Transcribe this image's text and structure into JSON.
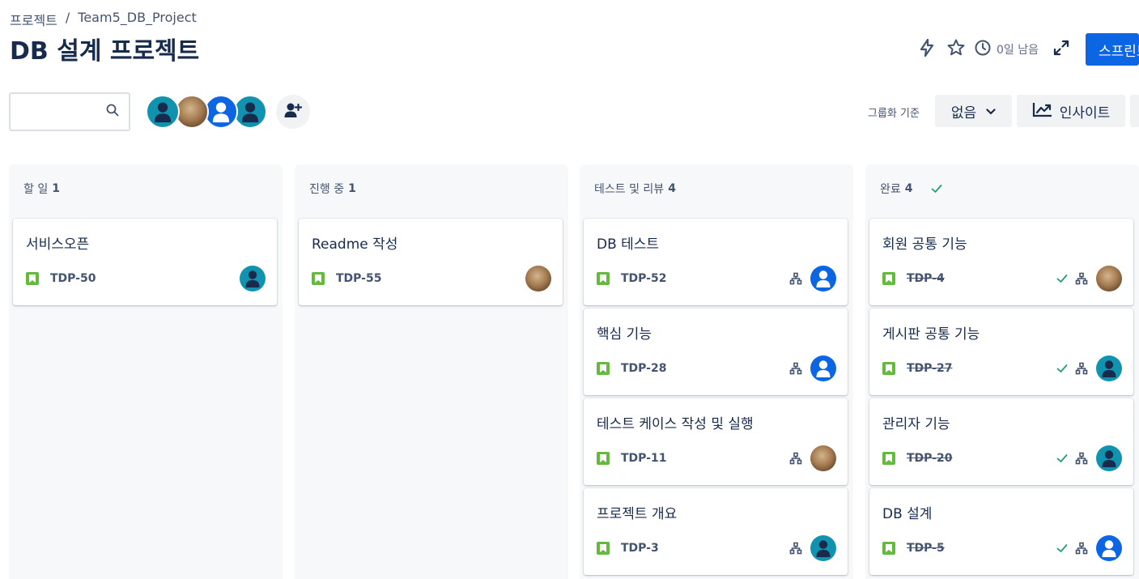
{
  "breadcrumb": {
    "root": "프로젝트",
    "separator": "/",
    "project": "Team5_DB_Project"
  },
  "page_title": "DB 설계 프로젝트",
  "top_actions": {
    "remaining": "0일 남음",
    "primary_button": "스프린트 완료"
  },
  "filters": {
    "search_placeholder": "",
    "group_label": "그룹화 기준",
    "group_value": "없음",
    "insight_label": "인사이트"
  },
  "avatars": [
    "teal",
    "photo",
    "blue",
    "teal"
  ],
  "columns": [
    {
      "title": "할 일",
      "count": "1",
      "done": false,
      "cards": [
        {
          "title": "서비스오픈",
          "key": "TDP-50",
          "done": false,
          "subtasks": false,
          "assignee": "teal"
        }
      ]
    },
    {
      "title": "진행 중",
      "count": "1",
      "done": false,
      "cards": [
        {
          "title": "Readme 작성",
          "key": "TDP-55",
          "done": false,
          "subtasks": false,
          "assignee": "photo"
        }
      ]
    },
    {
      "title": "테스트 및 리뷰",
      "count": "4",
      "done": false,
      "cards": [
        {
          "title": "DB 테스트",
          "key": "TDP-52",
          "done": false,
          "subtasks": true,
          "assignee": "blue"
        },
        {
          "title": "핵심 기능",
          "key": "TDP-28",
          "done": false,
          "subtasks": true,
          "assignee": "blue"
        },
        {
          "title": "테스트 케이스 작성 및 실행",
          "key": "TDP-11",
          "done": false,
          "subtasks": true,
          "assignee": "photo"
        },
        {
          "title": "프로젝트 개요",
          "key": "TDP-3",
          "done": false,
          "subtasks": true,
          "assignee": "teal"
        }
      ]
    },
    {
      "title": "완료",
      "count": "4",
      "done": true,
      "cards": [
        {
          "title": "회원 공통 기능",
          "key": "TDP-4",
          "done": true,
          "subtasks": true,
          "assignee": "photo"
        },
        {
          "title": "게시판 공통 기능",
          "key": "TDP-27",
          "done": true,
          "subtasks": true,
          "assignee": "teal"
        },
        {
          "title": "관리자 기능",
          "key": "TDP-20",
          "done": true,
          "subtasks": true,
          "assignee": "teal"
        },
        {
          "title": "DB 설계",
          "key": "TDP-5",
          "done": true,
          "subtasks": true,
          "assignee": "blue"
        }
      ]
    }
  ],
  "colors": {
    "primary": "#0c66e4",
    "story": "#63ba3c",
    "done": "#22a06b",
    "avatar_teal": "#1193b0"
  }
}
